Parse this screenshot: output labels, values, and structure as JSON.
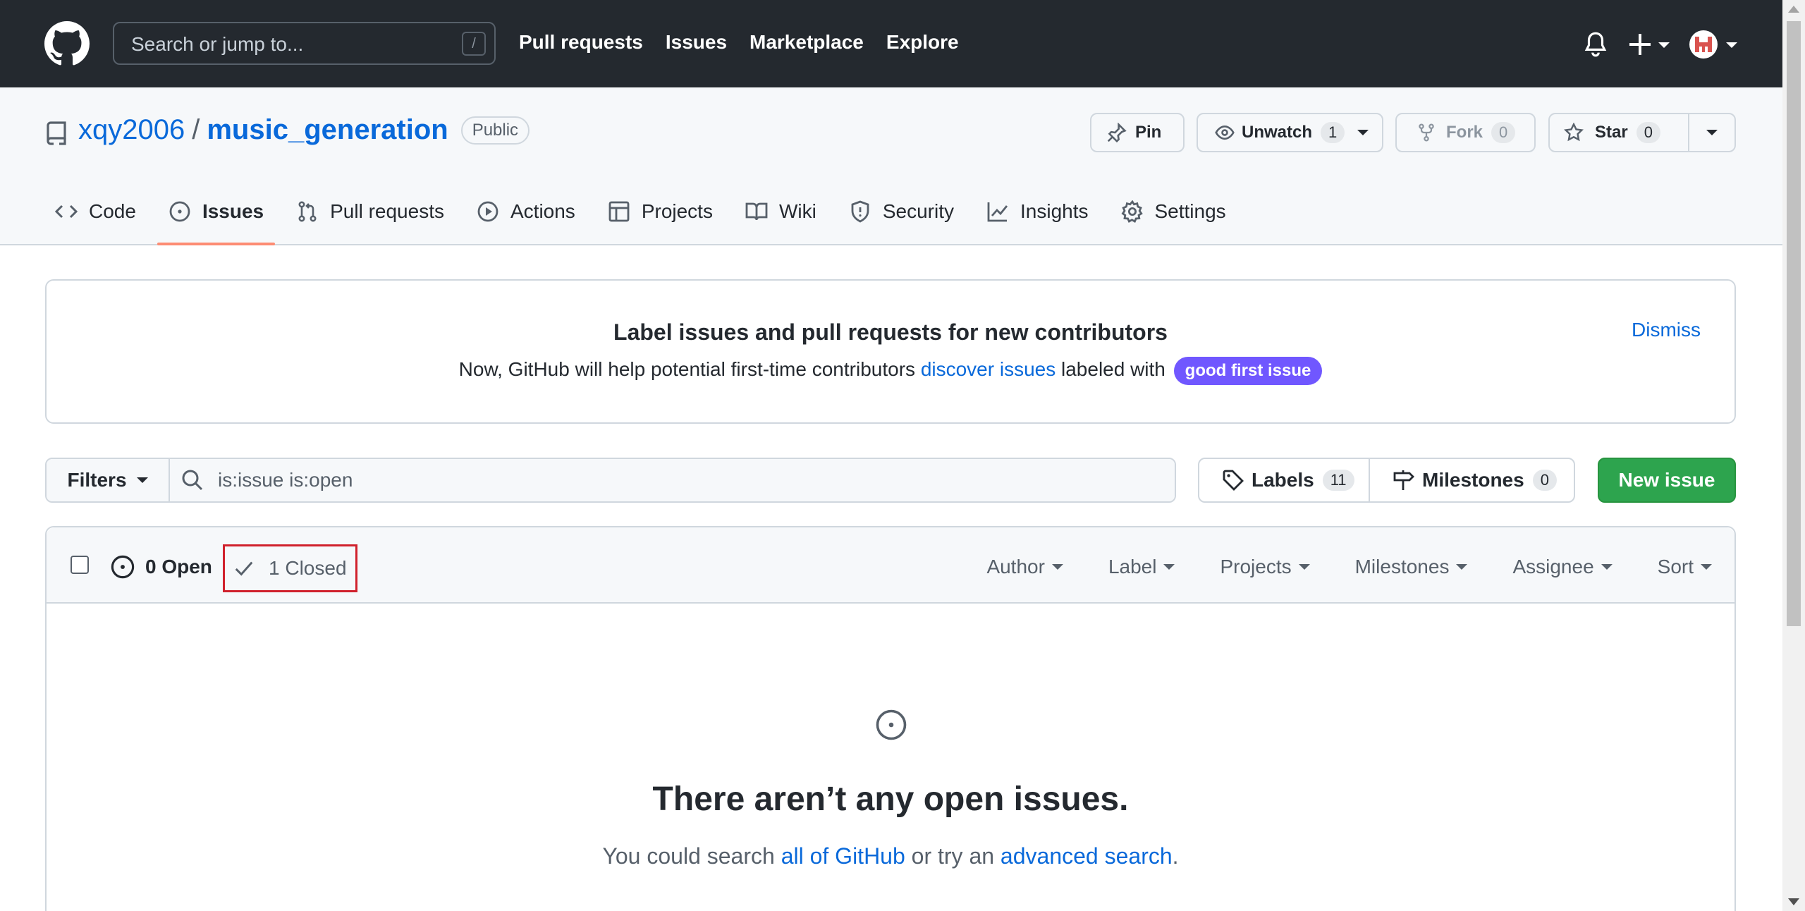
{
  "header": {
    "search_placeholder": "Search or jump to...",
    "search_shortcut": "/",
    "nav": [
      "Pull requests",
      "Issues",
      "Marketplace",
      "Explore"
    ]
  },
  "repo": {
    "owner": "xqy2006",
    "separator": "/",
    "name": "music_generation",
    "visibility": "Public",
    "pin_label": "Pin",
    "unwatch_label": "Unwatch",
    "watch_count": "1",
    "fork_label": "Fork",
    "fork_count": "0",
    "star_label": "Star",
    "star_count": "0"
  },
  "tabs": [
    {
      "label": "Code",
      "icon": "code-icon"
    },
    {
      "label": "Issues",
      "icon": "issue-opened-icon",
      "selected": true
    },
    {
      "label": "Pull requests",
      "icon": "git-pull-request-icon"
    },
    {
      "label": "Actions",
      "icon": "play-icon"
    },
    {
      "label": "Projects",
      "icon": "table-icon"
    },
    {
      "label": "Wiki",
      "icon": "book-icon"
    },
    {
      "label": "Security",
      "icon": "shield-icon"
    },
    {
      "label": "Insights",
      "icon": "graph-icon"
    },
    {
      "label": "Settings",
      "icon": "gear-icon"
    }
  ],
  "banner": {
    "title": "Label issues and pull requests for new contributors",
    "text_before": "Now, GitHub will help potential first-time contributors",
    "link": "discover issues",
    "text_after": "labeled with",
    "label": "good first issue",
    "label_color": "#7057ff",
    "dismiss": "Dismiss"
  },
  "filters": {
    "button": "Filters",
    "query": "is:issue is:open",
    "labels": "Labels",
    "labels_count": "11",
    "milestones": "Milestones",
    "milestones_count": "0",
    "new_issue": "New issue",
    "new_issue_color": "#2da44e"
  },
  "issues": {
    "open": "0 Open",
    "closed": "1 Closed",
    "selectors": [
      "Author",
      "Label",
      "Projects",
      "Milestones",
      "Assignee",
      "Sort"
    ],
    "empty_title": "There aren’t any open issues.",
    "empty_before": "You could search",
    "empty_link1": "all of GitHub",
    "empty_middle": "or try an",
    "empty_link2": "advanced search",
    "empty_after": "."
  }
}
